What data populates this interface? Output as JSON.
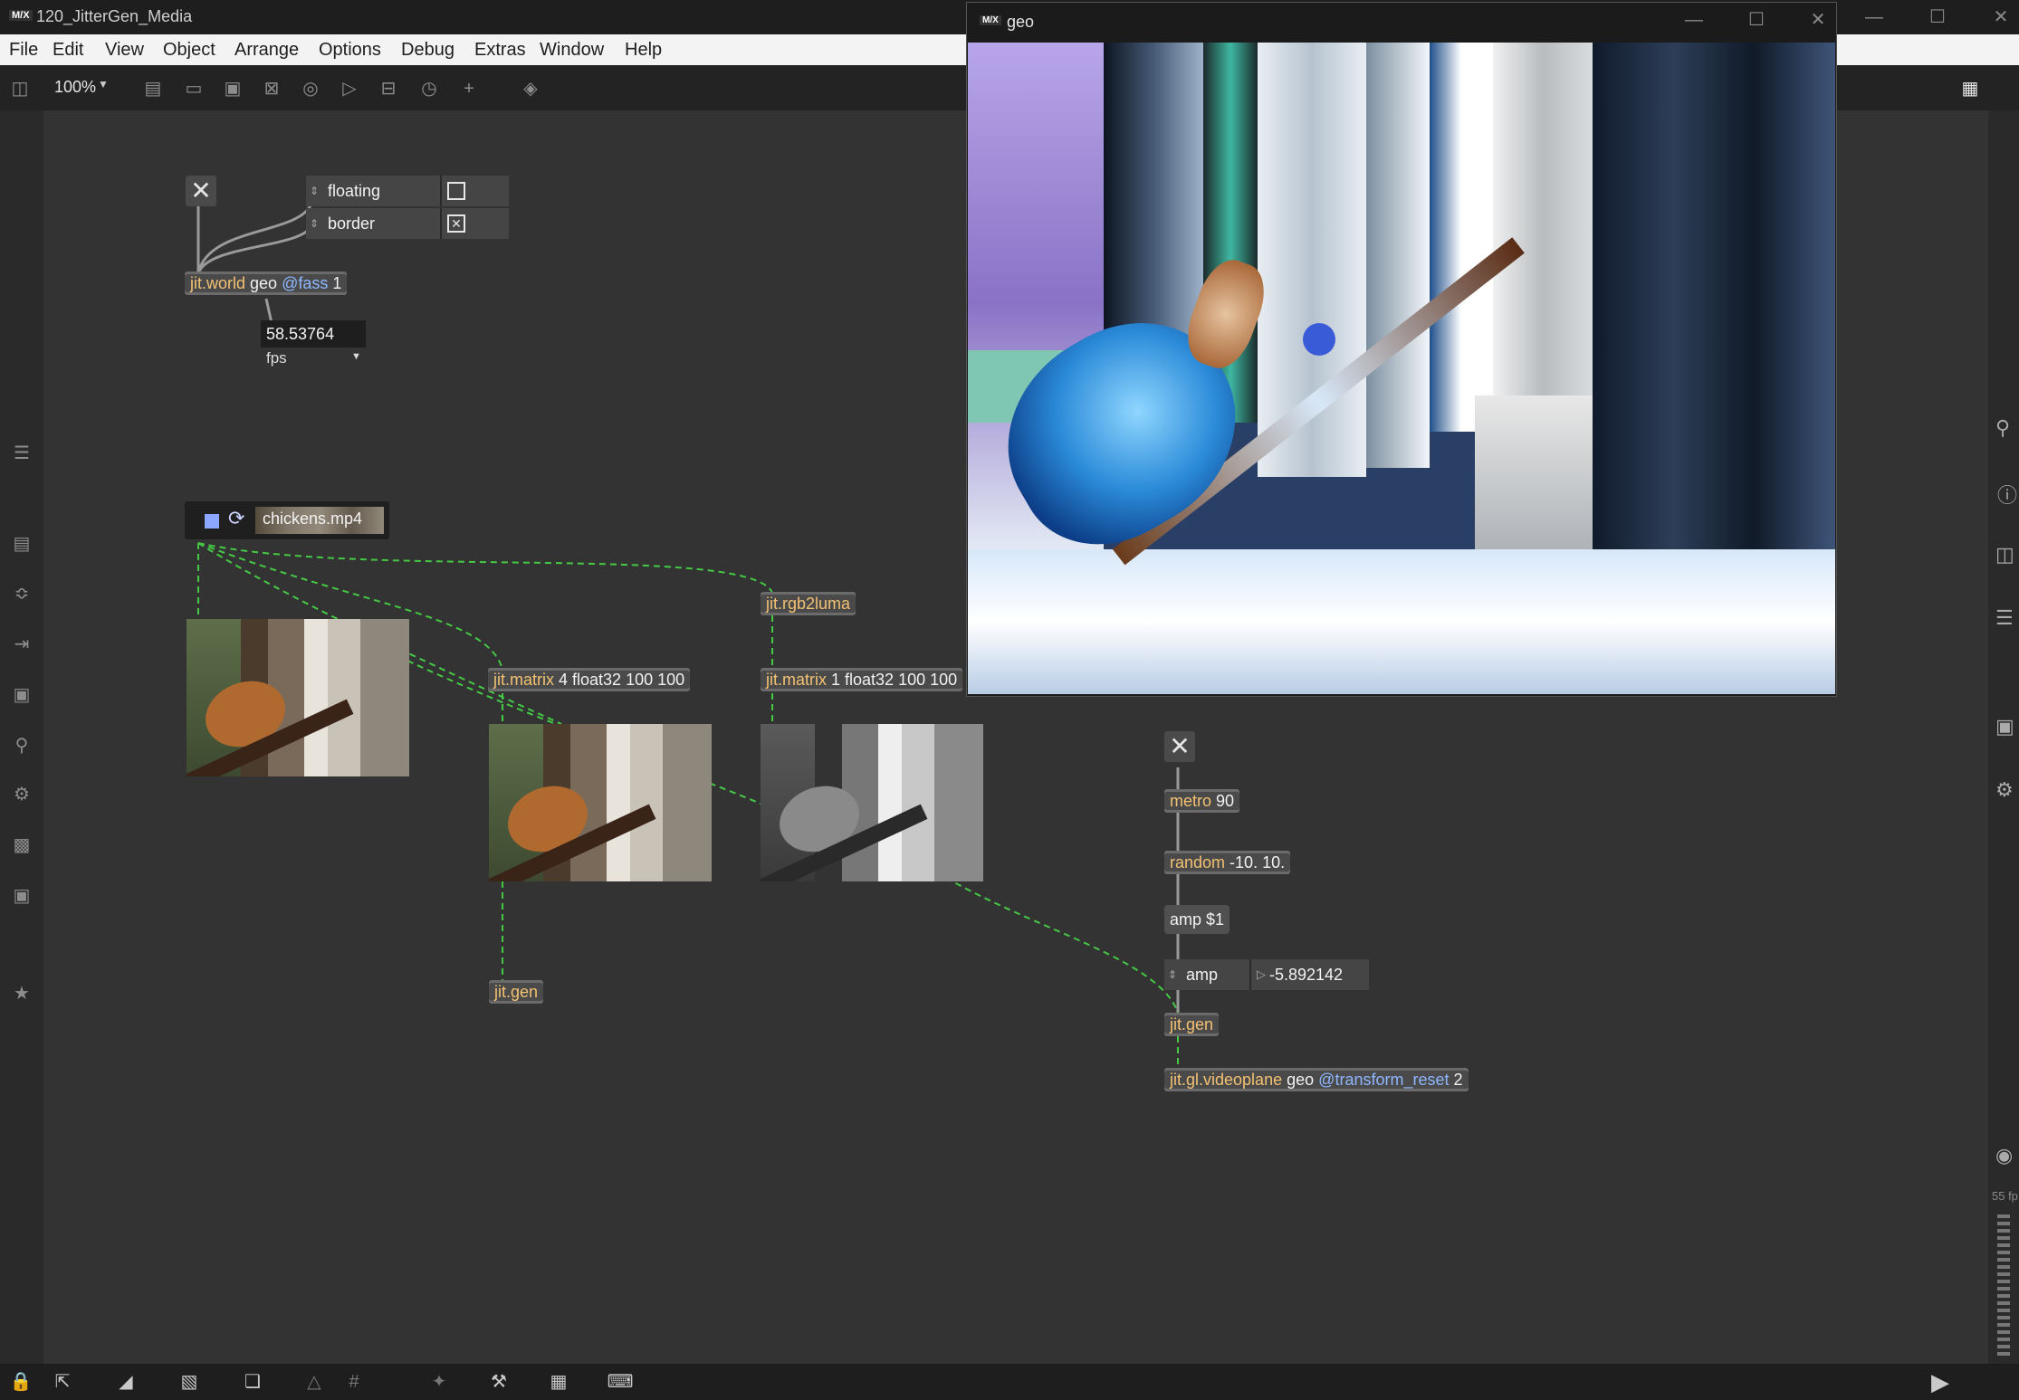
{
  "window": {
    "title": "120_JitterGen_Media",
    "logo": "M/X"
  },
  "menu": [
    "File",
    "Edit",
    "View",
    "Object",
    "Arrange",
    "Options",
    "Debug",
    "Extras",
    "Window",
    "Help"
  ],
  "toolbar": {
    "zoom": "100%"
  },
  "objects": {
    "world": {
      "cls": "jit.world",
      "arg": "geo",
      "attr": "@fass",
      "val": "1"
    },
    "fps_value": "58.53764",
    "fps_label": "fps",
    "floating": "floating",
    "border": "border",
    "movie": "chickens.mp4",
    "matrix4": {
      "cls": "jit.matrix",
      "arg": "4 float32 100 100"
    },
    "rgb2luma": {
      "cls": "jit.rgb2luma"
    },
    "matrix1": {
      "cls": "jit.matrix",
      "arg": "1 float32 100 100"
    },
    "gen1": {
      "cls": "jit.gen"
    },
    "metro": {
      "cls": "metro",
      "arg": "90"
    },
    "random": {
      "cls": "random",
      "arg": "-10. 10."
    },
    "ampmsg": "amp $1",
    "amp_label": "amp",
    "amp_value": "-5.892142",
    "gen2": {
      "cls": "jit.gen"
    },
    "videoplane": {
      "cls": "jit.gl.videoplane",
      "arg": "geo",
      "attr": "@transform_reset",
      "val": "2"
    }
  },
  "geo_window": {
    "title": "geo",
    "logo": "M/X"
  },
  "status": {
    "fps_side": "55 fp"
  }
}
